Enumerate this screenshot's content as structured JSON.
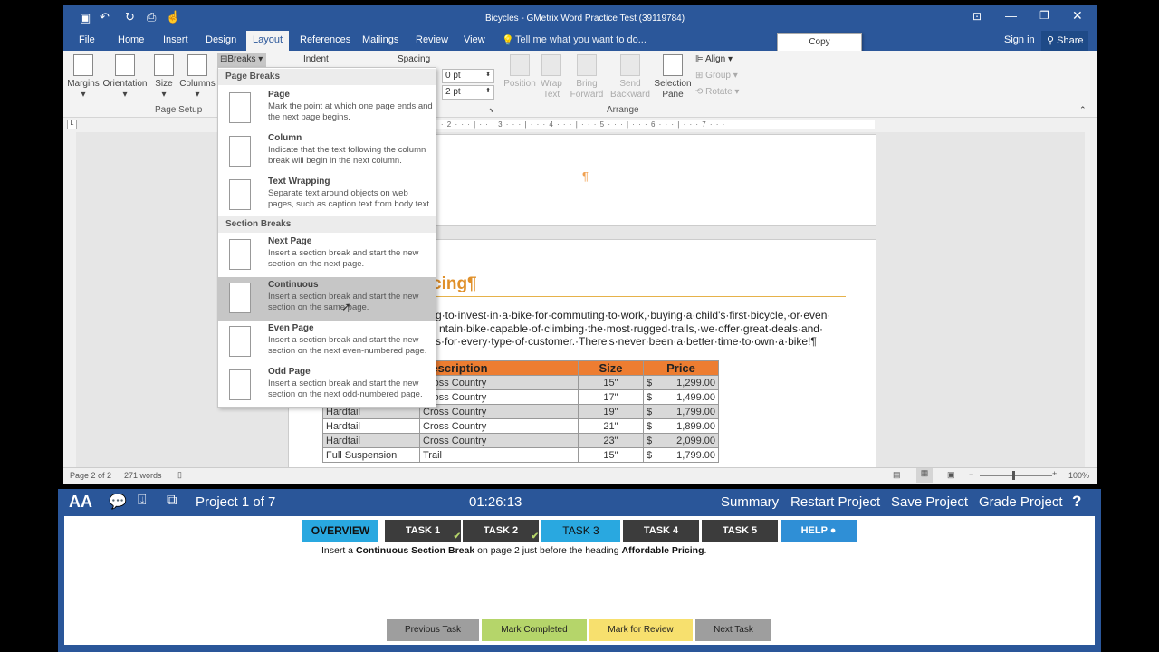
{
  "window": {
    "title": "Bicycles - GMetrix Word Practice Test (39119784)"
  },
  "tabs": [
    "File",
    "Home",
    "Insert",
    "Design",
    "Layout",
    "References",
    "Mailings",
    "Review",
    "View"
  ],
  "tell_me": "Tell me what you want to do...",
  "sign_in": "Sign in",
  "share": "Share",
  "copy_tooltip": "Copy",
  "ribbon": {
    "page_setup": {
      "margins": "Margins",
      "orientation": "Orientation",
      "size": "Size",
      "columns": "Columns",
      "breaks": "Breaks",
      "group": "Page Setup"
    },
    "indent": "Indent",
    "spacing": "Spacing",
    "spacing_before": "0 pt",
    "spacing_after": "2 pt",
    "arrange": {
      "position": "Position",
      "wrap_text": "Wrap Text",
      "bring_forward": "Bring Forward",
      "send_backward": "Send Backward",
      "selection_pane": "Selection Pane",
      "align": "Align",
      "group_btn": "Group",
      "rotate": "Rotate",
      "group": "Arrange"
    }
  },
  "ruler": "· · 2 · · · | · · · 3 · · · | · · · 4 · · · | · · · 5 · · · | · · · 6 · · · | · · · 7 · · ·",
  "breaks_menu": {
    "page_breaks_header": "Page Breaks",
    "section_breaks_header": "Section Breaks",
    "items": [
      {
        "title": "Page",
        "desc": "Mark the point at which one page ends and the next page begins."
      },
      {
        "title": "Column",
        "desc": "Indicate that the text following the column break will begin in the next column."
      },
      {
        "title": "Text Wrapping",
        "desc": "Separate text around objects on web pages, such as caption text from body text."
      },
      {
        "title": "Next Page",
        "desc": "Insert a section break and start the new section on the next page."
      },
      {
        "title": "Continuous",
        "desc": "Insert a section break and start the new section on the same page."
      },
      {
        "title": "Even Page",
        "desc": "Insert a section break and start the new section on the next even-numbered page."
      },
      {
        "title": "Odd Page",
        "desc": "Insert a section break and start the new section on the next odd-numbered page."
      }
    ]
  },
  "document": {
    "pilcrow": "¶",
    "heading_fragment": "cing¶",
    "para_lines": [
      "g·to·invest·in·a·bike·for·commuting·to·work,·buying·a·child's·first·bicycle,·or·even·",
      "ntain·bike·capable·of·climbing·the·most·rugged·trails,·we·offer·great·deals·and·",
      "s·for·every·type·of·customer.·There's·never·been·a·better·time·to·own·a·bike!¶"
    ],
    "table": {
      "headers": [
        "",
        "Description",
        "Size",
        "Price"
      ],
      "rows": [
        [
          "",
          "Cross Country",
          "15\"",
          "$",
          "1,299.00"
        ],
        [
          "",
          "Cross Country",
          "17\"",
          "$",
          "1,499.00"
        ],
        [
          "Hardtail",
          "Cross Country",
          "19\"",
          "$",
          "1,799.00"
        ],
        [
          "Hardtail",
          "Cross Country",
          "21\"",
          "$",
          "1,899.00"
        ],
        [
          "Hardtail",
          "Cross Country",
          "23\"",
          "$",
          "2,099.00"
        ],
        [
          "Full Suspension",
          "Trail",
          "15\"",
          "$",
          "1,799.00"
        ]
      ]
    }
  },
  "status": {
    "page": "Page 2 of 2",
    "words": "271 words",
    "zoom": "100%"
  },
  "gmetrix": {
    "project": "Project 1 of 7",
    "timer": "01:26:13",
    "links": [
      "Summary",
      "Restart Project",
      "Save Project",
      "Grade Project"
    ],
    "help_q": "?",
    "tabs": [
      "OVERVIEW",
      "TASK 1",
      "TASK 2",
      "TASK 3",
      "TASK 4",
      "TASK 5",
      "HELP"
    ],
    "task_text": {
      "a": "Insert a ",
      "b": "Continuous Section Break",
      "c": " on page 2 just before the heading ",
      "d": "Affordable Pricing",
      "e": "."
    },
    "buttons": [
      "Previous Task",
      "Mark Completed",
      "Mark for Review",
      "Next Task"
    ],
    "colors": {
      "blue": "#2a5699",
      "active_tab": "#29a8e0",
      "dark_tab": "#3c3c3c",
      "help": "#2f8fd6",
      "completed": "#b5d56a",
      "review": "#f7e06e",
      "nav": "#9e9e9e"
    }
  }
}
